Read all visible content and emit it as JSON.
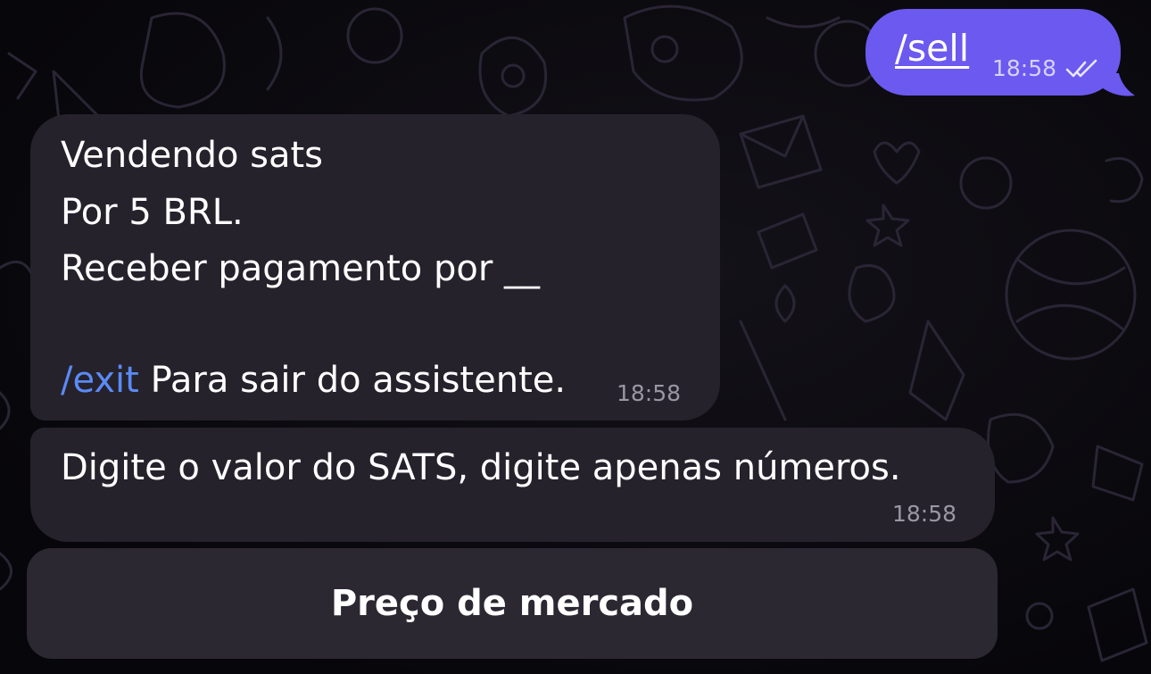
{
  "outgoing_message": {
    "text": "/sell",
    "time": "18:58",
    "status_icon": "double-check-icon",
    "bubble_color": "#6b59f0"
  },
  "incoming_messages": [
    {
      "lines": [
        "Vendendo sats",
        "Por 5 BRL.",
        "Receber pagamento por __",
        ""
      ],
      "command": "/exit",
      "command_text": " Para sair do assistente.",
      "time": "18:58"
    },
    {
      "text": "Digite o valor do SATS, digite apenas números.",
      "time": "18:58"
    }
  ],
  "keyboard_button": {
    "label": "Preço de mercado"
  },
  "colors": {
    "incoming_bubble": "#25222c",
    "link": "#5b8af5",
    "background": "#0b0a0f"
  }
}
